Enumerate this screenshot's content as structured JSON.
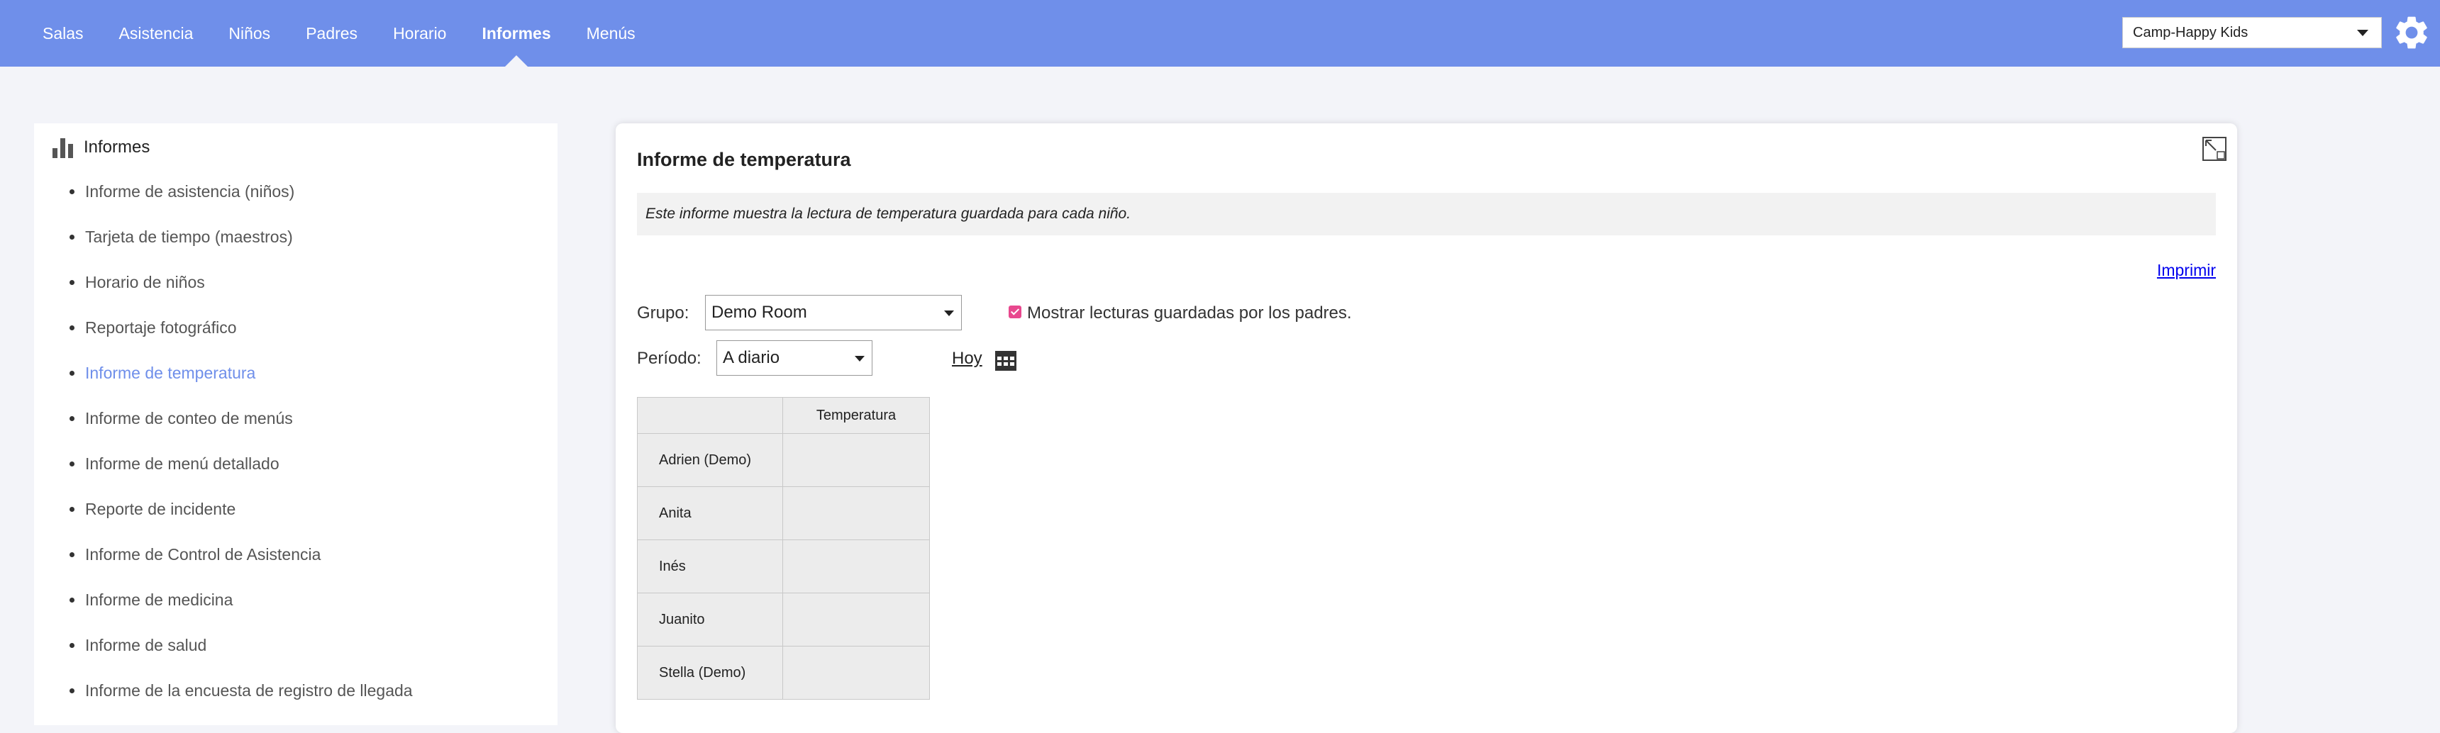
{
  "nav": {
    "items": [
      {
        "label": "Salas"
      },
      {
        "label": "Asistencia"
      },
      {
        "label": "Niños"
      },
      {
        "label": "Padres"
      },
      {
        "label": "Horario"
      },
      {
        "label": "Informes",
        "active": true
      },
      {
        "label": "Menús"
      }
    ],
    "center_select": "Camp-Happy Kids",
    "settings_icon": "gear-icon"
  },
  "sidebar": {
    "title": "Informes",
    "items": [
      {
        "label": "Informe de asistencia (niños)"
      },
      {
        "label": "Tarjeta de tiempo (maestros)"
      },
      {
        "label": "Horario de niños"
      },
      {
        "label": "Reportaje fotográfico"
      },
      {
        "label": "Informe de temperatura",
        "active": true
      },
      {
        "label": "Informe de conteo de menús"
      },
      {
        "label": "Informe de menú detallado"
      },
      {
        "label": "Reporte de incidente"
      },
      {
        "label": "Informe de Control de Asistencia"
      },
      {
        "label": "Informe de medicina"
      },
      {
        "label": "Informe de salud"
      },
      {
        "label": "Informe de la encuesta de registro de llegada"
      }
    ]
  },
  "report": {
    "title": "Informe de temperatura",
    "description": "Este informe muestra la lectura de temperatura guardada para cada niño.",
    "print_label": "Imprimir",
    "group_label": "Grupo:",
    "group_value": "Demo Room",
    "show_parents_label": "Mostrar lecturas guardadas por los padres.",
    "show_parents_checked": true,
    "period_label": "Período:",
    "period_value": "A diario",
    "today_label": "Hoy",
    "table": {
      "columns": [
        "",
        "Temperatura"
      ],
      "rows": [
        {
          "name": "Adrien (Demo)",
          "temperature": ""
        },
        {
          "name": "Anita",
          "temperature": ""
        },
        {
          "name": "Inés",
          "temperature": ""
        },
        {
          "name": "Juanito",
          "temperature": ""
        },
        {
          "name": "Stella (Demo)",
          "temperature": ""
        }
      ]
    }
  },
  "colors": {
    "accent": "#6f8fea",
    "checkbox": "#e8488e",
    "link": "#0000ee"
  }
}
